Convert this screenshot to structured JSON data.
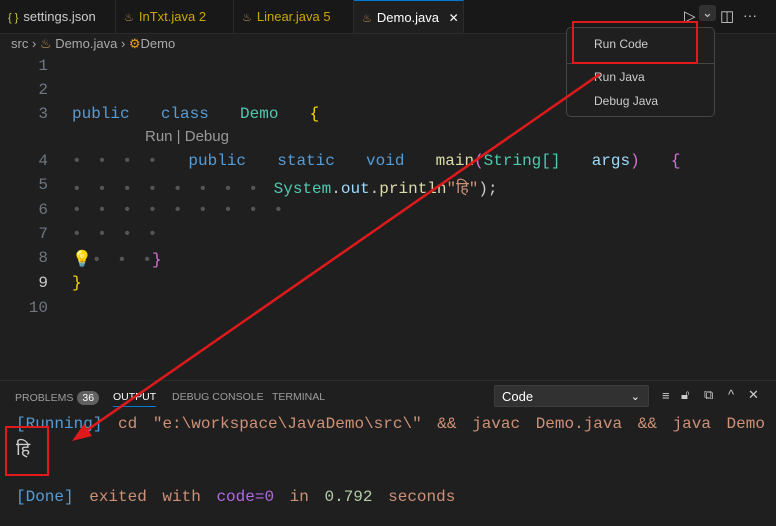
{
  "tabs": [
    {
      "label": "settings.json",
      "icon": "{ }",
      "color": "#cccccc"
    },
    {
      "label": "InTxt.java 2",
      "color": "#cca700"
    },
    {
      "label": "Linear.java 5",
      "color": "#cca700"
    },
    {
      "label": "Demo.java",
      "color": "#ffffff",
      "close": "✕"
    }
  ],
  "toolbar": {
    "run": "▷",
    "dropdown": "⌄",
    "split": "◫",
    "more": "···"
  },
  "breadcrumb": {
    "src": "src",
    "file": "Demo.java",
    "cls": "Demo"
  },
  "line_numbers": [
    "1",
    "2",
    "3",
    "4",
    "5",
    "6",
    "7",
    "8",
    "9",
    "10"
  ],
  "code": {
    "public": "public",
    "class": "class",
    "Demo": "Demo",
    "brace_open": "{",
    "codelens": "Run | Debug",
    "static": "static",
    "void": "void",
    "main": "main",
    "String": "String[]",
    "args": "args",
    "System": "System",
    "out": "out",
    "println": "println",
    "str": "\"हि\"",
    "close_paren": ");",
    "brace_close": "}"
  },
  "menu": {
    "items": [
      "Run Code",
      "Run Java",
      "Debug Java"
    ]
  },
  "panel": {
    "tabs": [
      "PROBLEMS",
      "OUTPUT",
      "DEBUG CONSOLE",
      "TERMINAL"
    ],
    "problems_count": "36",
    "channel": "Code",
    "icons": [
      "clear-output",
      "lock",
      "copy",
      "maximize",
      "close"
    ]
  },
  "output": {
    "running": "[Running]",
    "cmd": "cd \"e:\\workspace\\JavaDemo\\src\\\" && javac Demo.java && java Demo",
    "result": "हि",
    "done": "[Done]",
    "exited": "exited with",
    "code": "code=0",
    "in": "in",
    "time": "0.792",
    "seconds": "seconds"
  }
}
